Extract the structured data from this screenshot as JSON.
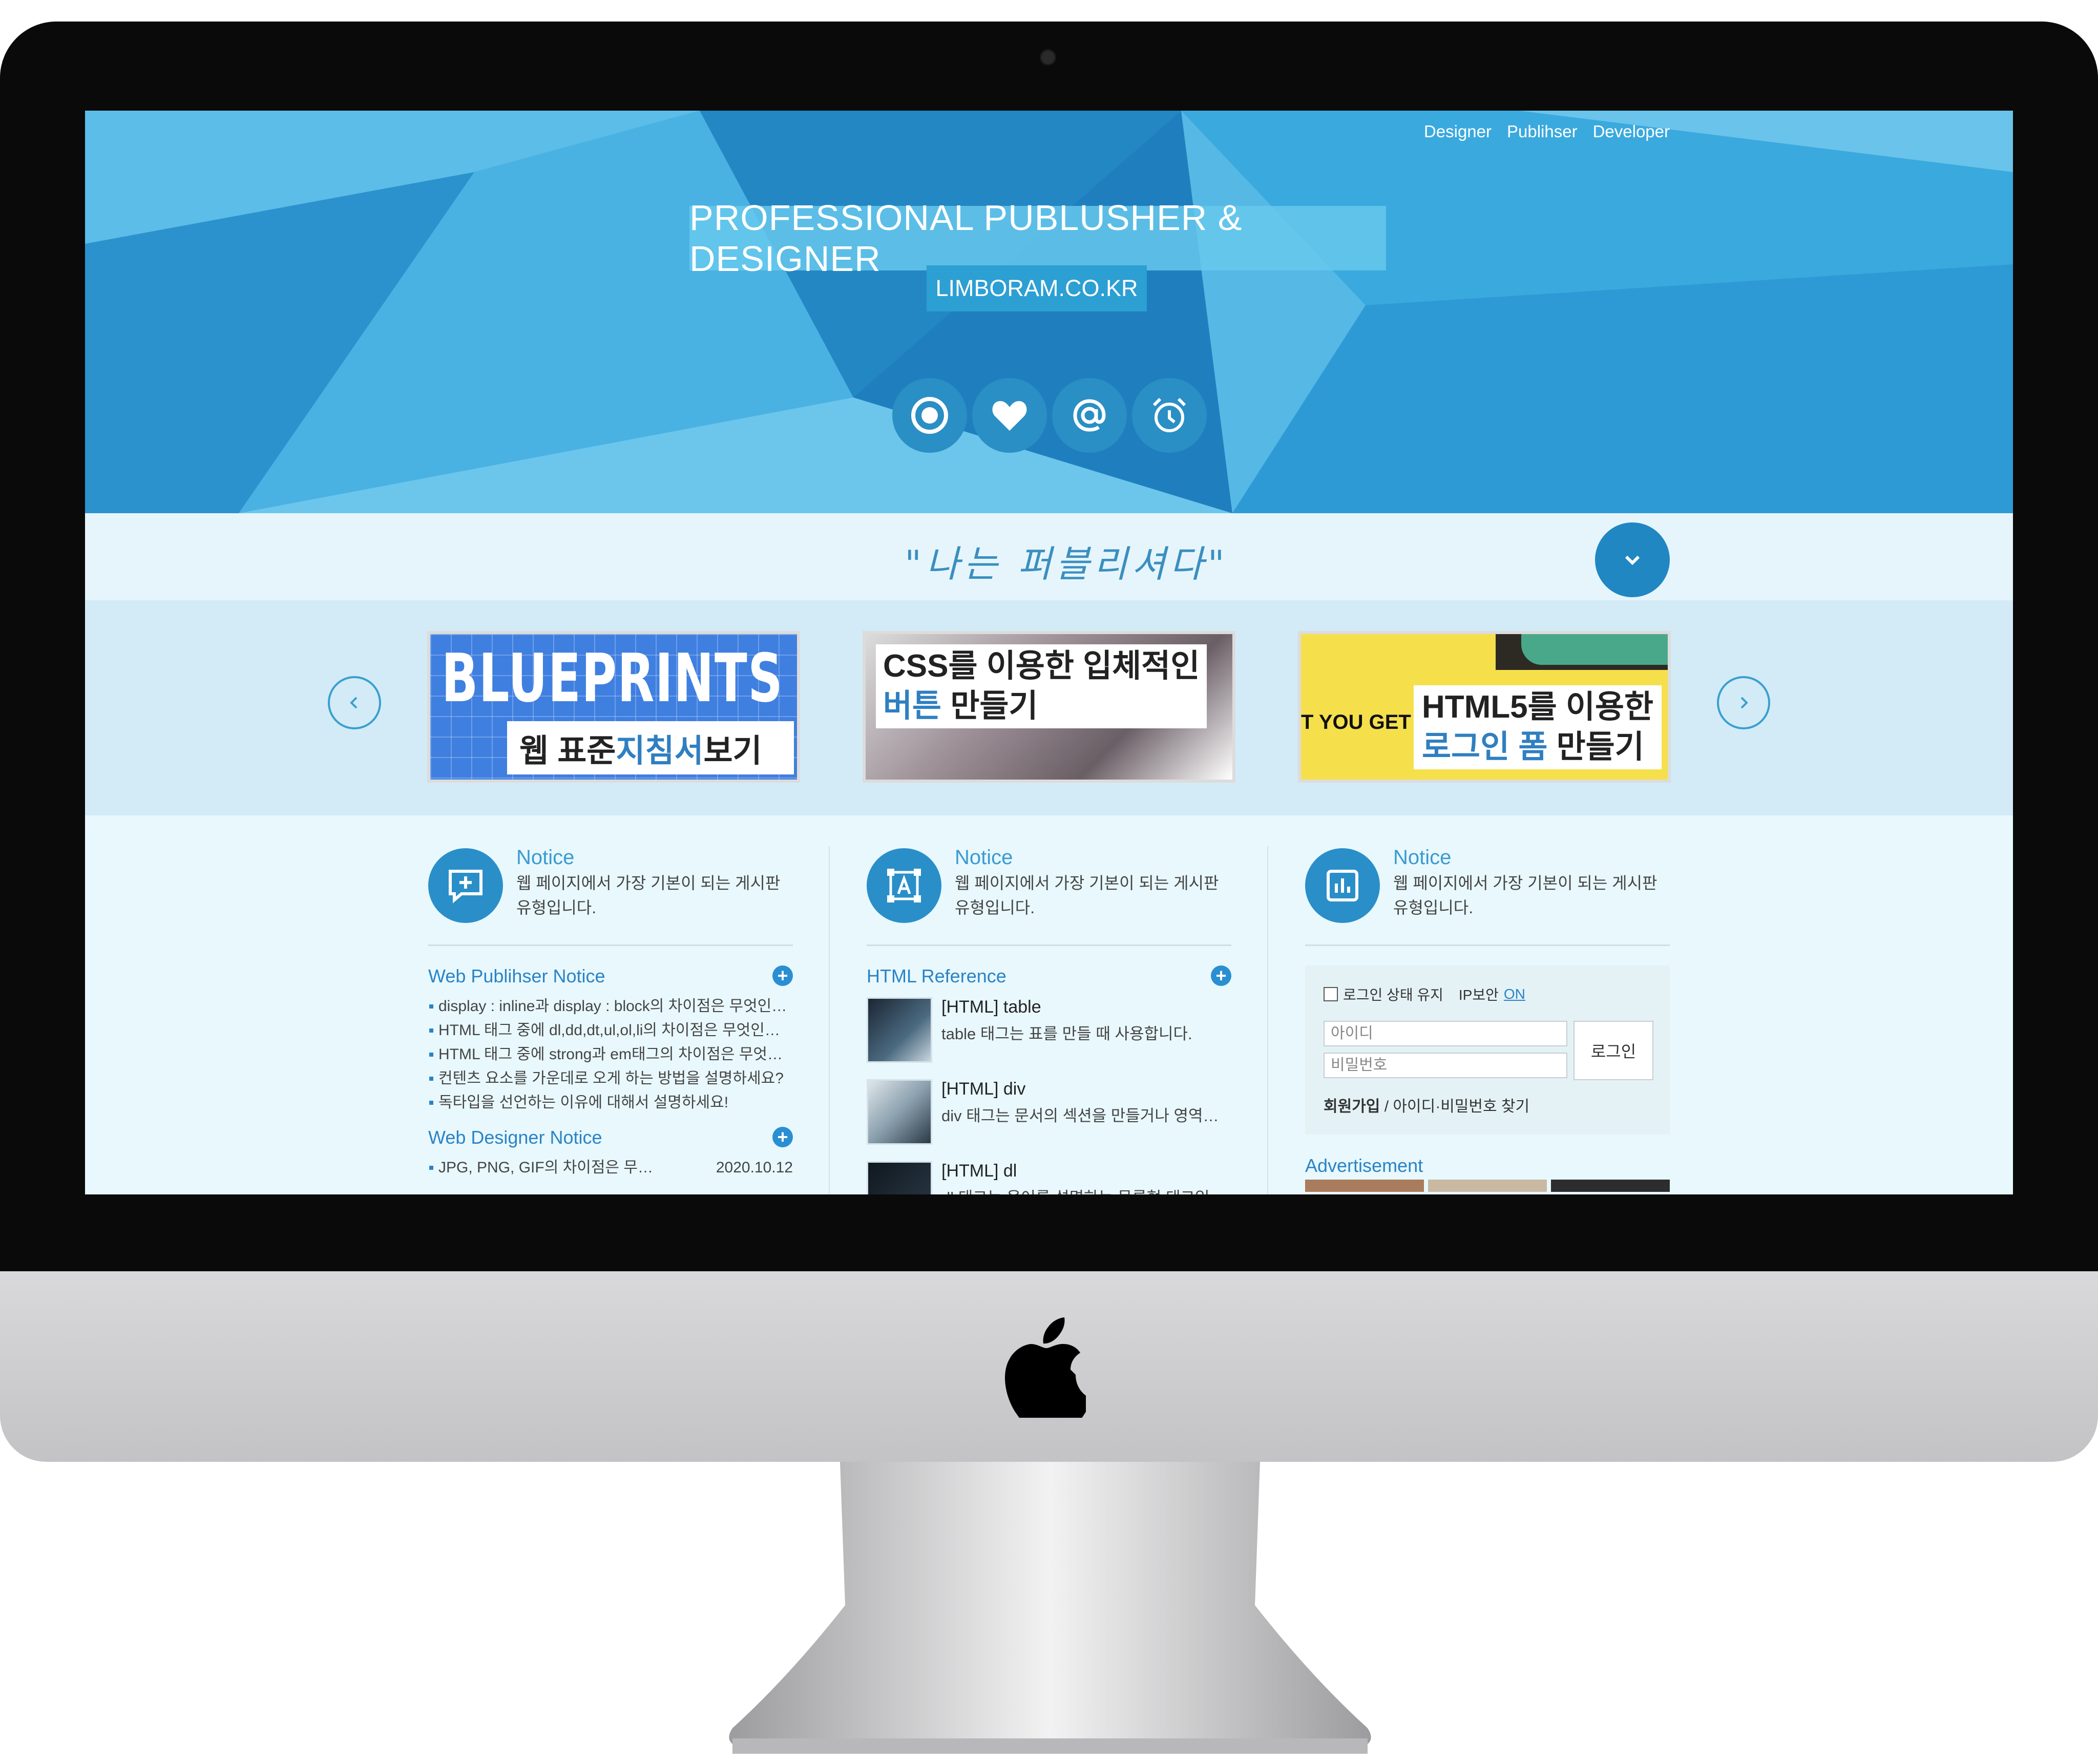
{
  "nav": {
    "links": [
      "Designer",
      "Publihser",
      "Developer"
    ]
  },
  "hero": {
    "title": "PROFESSIONAL PUBLUSHER & DESIGNER",
    "subtitle": "LIMBORAM.CO.KR",
    "icons": [
      "target-icon",
      "heart-icon",
      "at-icon",
      "alarm-clock-icon"
    ]
  },
  "slogan": "\"나는 퍼블리셔다\"",
  "slider": {
    "banners": [
      {
        "big": "BLUEPRINTS",
        "label_plain": "웹 표준 ",
        "label_blue": "지침서",
        "label_rest": " 보기"
      },
      {
        "line1": "CSS를 이용한 입체적인",
        "line2_blue": "버튼",
        "line2_rest": " 만들기"
      },
      {
        "small": "T YOU GET",
        "line1": "HTML5를 이용한",
        "line2_blue": "로그인 폼",
        "line2_rest": " 만들기"
      }
    ]
  },
  "columns": [
    {
      "head_title": "Notice",
      "head_desc": "웹 페이지에서 가장 기본이 되는 게시판 유형입니다.",
      "section1_title": "Web Publihser Notice",
      "section1_items": [
        "display : inline과 display : block의 차이점은 무엇인가요?",
        "HTML 태그 중에 dl,dd,dt,ul,ol,li의 차이점은 무엇인가요?",
        "HTML 태그 중에 strong과 em태그의 차이점은 무엇인가요?",
        "컨텐츠 요소를 가운데로 오게 하는 방법을 설명하세요?",
        "독타입을 선언하는 이유에 대해서 설명하세요!"
      ],
      "section2_title": "Web Designer Notice",
      "section2_item": "JPG, PNG, GIF의 차이점은 무엇인가요?",
      "section2_date": "2020.10.12"
    },
    {
      "head_title": "Notice",
      "head_desc": "웹 페이지에서 가장 기본이 되는 게시판 유형입니다.",
      "section_title": "HTML Reference",
      "refs": [
        {
          "title": "[HTML] table",
          "desc": "table 태그는 표를 만들 때 사용합니다."
        },
        {
          "title": "[HTML] div",
          "desc": "div 태그는 문서의 섹션을 만들거나 영역을 나눕니다."
        },
        {
          "title": "[HTML] dl",
          "desc": "dl 태그는 용어를 설명하는 목록형 태그입니다."
        }
      ]
    },
    {
      "head_title": "Notice",
      "head_desc": "웹 페이지에서 가장 기본이 되는 게시판 유형입니다.",
      "login": {
        "keep_label": "로그인 상태 유지",
        "ip_label": "IP보안",
        "ip_value": "ON",
        "id_placeholder": "아이디",
        "pw_placeholder": "비밀번호",
        "button": "로그인",
        "join": "회원가입",
        "sep": " / ",
        "find": "아이디·비밀번호 찾기"
      },
      "adv_title": "Advertisement"
    }
  ],
  "colors": {
    "accent": "#2a8fc8",
    "hero": "#2d9fd8",
    "band": "#e6f5fc",
    "slider_bg": "#d3ebf6"
  }
}
